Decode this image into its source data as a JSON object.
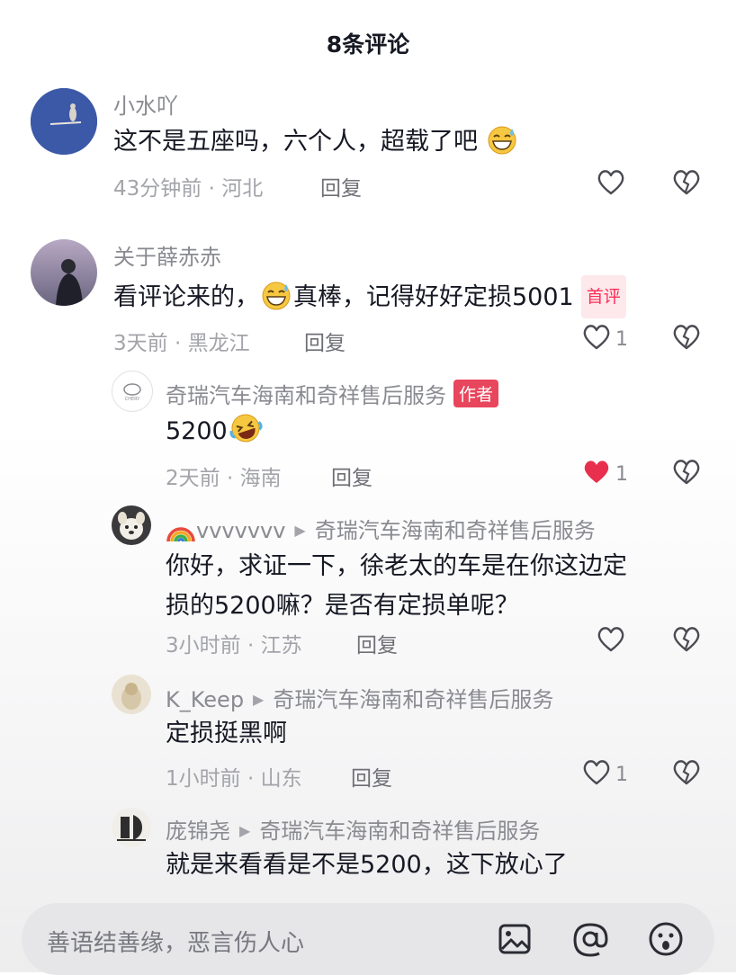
{
  "header": {
    "title": "8条评论"
  },
  "comments": [
    {
      "username": "小水吖",
      "text": "这不是五座吗，六个人，超载了吧",
      "emoji": "grin-sweat-emoji",
      "meta": "43分钟前 · 河北",
      "reply": "回复",
      "likes": ""
    },
    {
      "username": "关于薛赤赤",
      "text_before": "看评论来的，",
      "emoji": "grin-sweat-emoji",
      "text_after": "真棒，记得好好定损5001",
      "badge": "首评",
      "meta": "3天前 · 黑龙江",
      "reply": "回复",
      "likes": "1"
    }
  ],
  "replies": [
    {
      "username": "奇瑞汽车海南和奇祥售后服务",
      "badge": "作者",
      "text": "5200",
      "emoji": "laughing-tears-emoji",
      "meta": "2天前 · 海南",
      "reply": "回复",
      "likes": "1",
      "liked": true
    },
    {
      "username": "vvvvvvv",
      "username_prefix_icon": "rainbow-icon",
      "reply_to": "奇瑞汽车海南和奇祥售后服务",
      "text_line1": "你好，求证一下，徐老太的车是在你这边定",
      "text_line2": "损的5200嘛？是否有定损单呢？",
      "meta": "3小时前 · 江苏",
      "reply": "回复",
      "likes": ""
    },
    {
      "username": "K_Keep",
      "reply_to": "奇瑞汽车海南和奇祥售后服务",
      "text": "定损挺黑啊",
      "meta": "1小时前 · 山东",
      "reply": "回复",
      "likes": "1"
    },
    {
      "username": "庞锦尧",
      "reply_to": "奇瑞汽车海南和奇祥售后服务",
      "text": "就是来看看是不是5200，这下放心了"
    }
  ],
  "input": {
    "placeholder": "善语结善缘，恶言伤人心"
  },
  "colors": {
    "accent": "#fe2c55",
    "text": "#161823",
    "secondary": "#a3a4a9"
  }
}
